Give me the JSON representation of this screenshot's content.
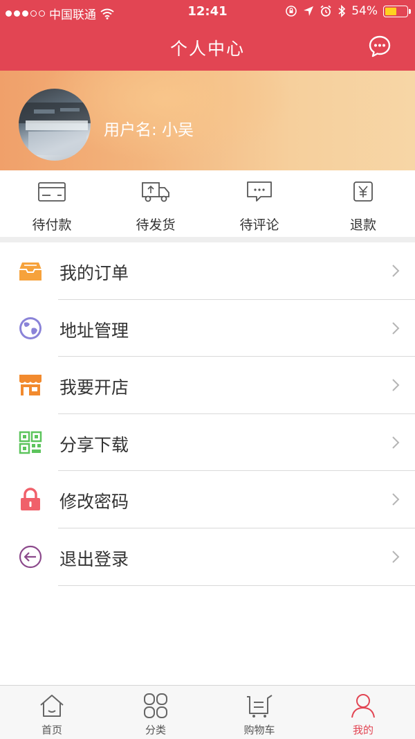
{
  "status_bar": {
    "carrier": "中国联通",
    "time": "12:41",
    "battery": "54%",
    "battery_level": 0.54,
    "signal_icon": "signal-dots-icon",
    "wifi_icon": "wifi-icon"
  },
  "nav": {
    "title": "个人中心",
    "message_icon": "chat-bubble-icon"
  },
  "profile": {
    "username": "用户名: 小吴"
  },
  "order_status": [
    {
      "label": "待付款",
      "icon": "card-icon"
    },
    {
      "label": "待发货",
      "icon": "truck-icon"
    },
    {
      "label": "待评论",
      "icon": "comment-icon"
    },
    {
      "label": "退款",
      "icon": "yen-icon"
    }
  ],
  "menu": [
    {
      "label": "我的订单",
      "icon": "inbox-icon",
      "color": "#f6a23c"
    },
    {
      "label": "地址管理",
      "icon": "globe-icon",
      "color": "#8a83d8"
    },
    {
      "label": "我要开店",
      "icon": "store-icon",
      "color": "#f28a2e"
    },
    {
      "label": "分享下载",
      "icon": "qr-code-icon",
      "color": "#5cc45c"
    },
    {
      "label": "修改密码",
      "icon": "lock-icon",
      "color": "#f0606a"
    },
    {
      "label": "退出登录",
      "icon": "logout-arrow-icon",
      "color": "#8c4a8c"
    }
  ],
  "tabs": [
    {
      "label": "首页",
      "icon": "home-icon",
      "active": false
    },
    {
      "label": "分类",
      "icon": "grid-icon",
      "active": false
    },
    {
      "label": "购物车",
      "icon": "cart-icon",
      "active": false
    },
    {
      "label": "我的",
      "icon": "user-icon",
      "active": true
    }
  ],
  "colors": {
    "brand": "#e24553",
    "text": "#333333",
    "divider": "#d9d9d9"
  }
}
